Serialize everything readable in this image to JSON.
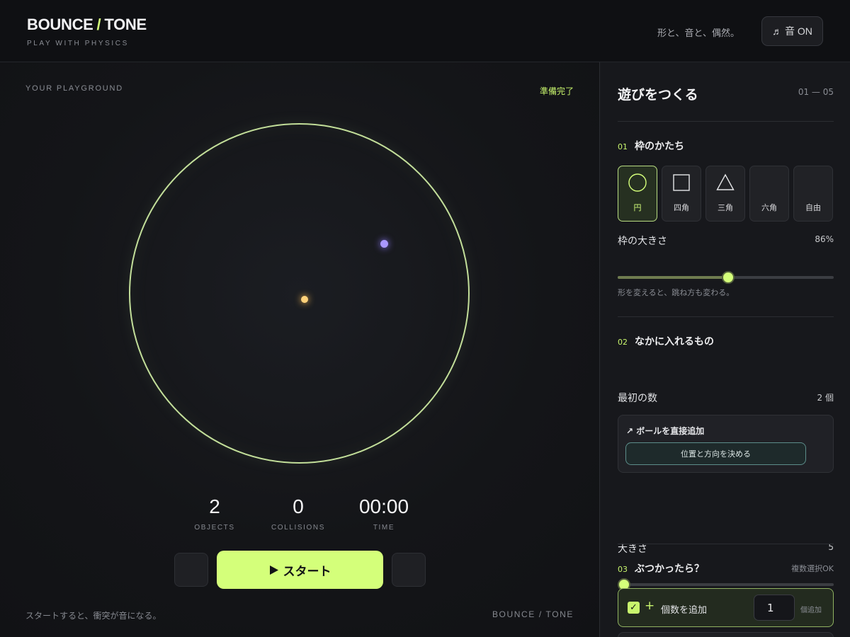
{
  "header": {
    "brand_left": "BOUNCE",
    "brand_slash": "/",
    "brand_right": "TONE",
    "brand_sub": "PLAY WITH PHYSICS",
    "tagline": "形と、音と、偶然。",
    "sound_label": "♬ 音 ON"
  },
  "stage": {
    "label": "YOUR PLAYGROUND",
    "status": "準備完了",
    "stats": [
      {
        "value": "2",
        "label": "OBJECTS"
      },
      {
        "value": "0",
        "label": "COLLISIONS"
      },
      {
        "value": "00:00",
        "label": "TIME"
      }
    ],
    "start_label": "スタート",
    "footer_left": "スタートすると、衝突が音になる。",
    "footer_right": "BOUNCE / TONE",
    "colors": {
      "accent": "#d4ff7a",
      "arena": "#c3df9a",
      "ball_a": "#a997ff",
      "ball_b": "#ffd27a"
    }
  },
  "panel": {
    "title": "遊びをつくる",
    "step": "01 — 05",
    "section1": {
      "num": "01",
      "title": "枠のかたち",
      "shapes": [
        {
          "label": "円",
          "icon": "circle-icon",
          "active": true
        },
        {
          "label": "四角",
          "icon": "square-icon"
        },
        {
          "label": "三角",
          "icon": "triangle-icon"
        },
        {
          "label": "六角",
          "icon": ""
        },
        {
          "label": "自由",
          "icon": ""
        }
      ],
      "size_label": "枠の大きさ",
      "size_value": "86%",
      "size_fraction": 0.51,
      "hint": "形を変えると、跳ね方も変わる。"
    },
    "section2": {
      "num": "02",
      "title": "なかに入れるもの",
      "count_label": "最初の数",
      "count_value": "2 個",
      "count_fraction": 0.075,
      "add_title": "↗ ボールを直接追加",
      "add_button": "位置と方向を決める",
      "ballsize_label": "大きさ",
      "ballsize_value": "5",
      "ballsize_fraction": 0.03
    },
    "section3": {
      "num": "03",
      "title": "ぶつかったら？",
      "note": "複数選択OK",
      "option_check": "✓",
      "option_plus": "+",
      "option_label": "個数を追加",
      "option_qty": "1",
      "option_unit": "個追加"
    }
  }
}
